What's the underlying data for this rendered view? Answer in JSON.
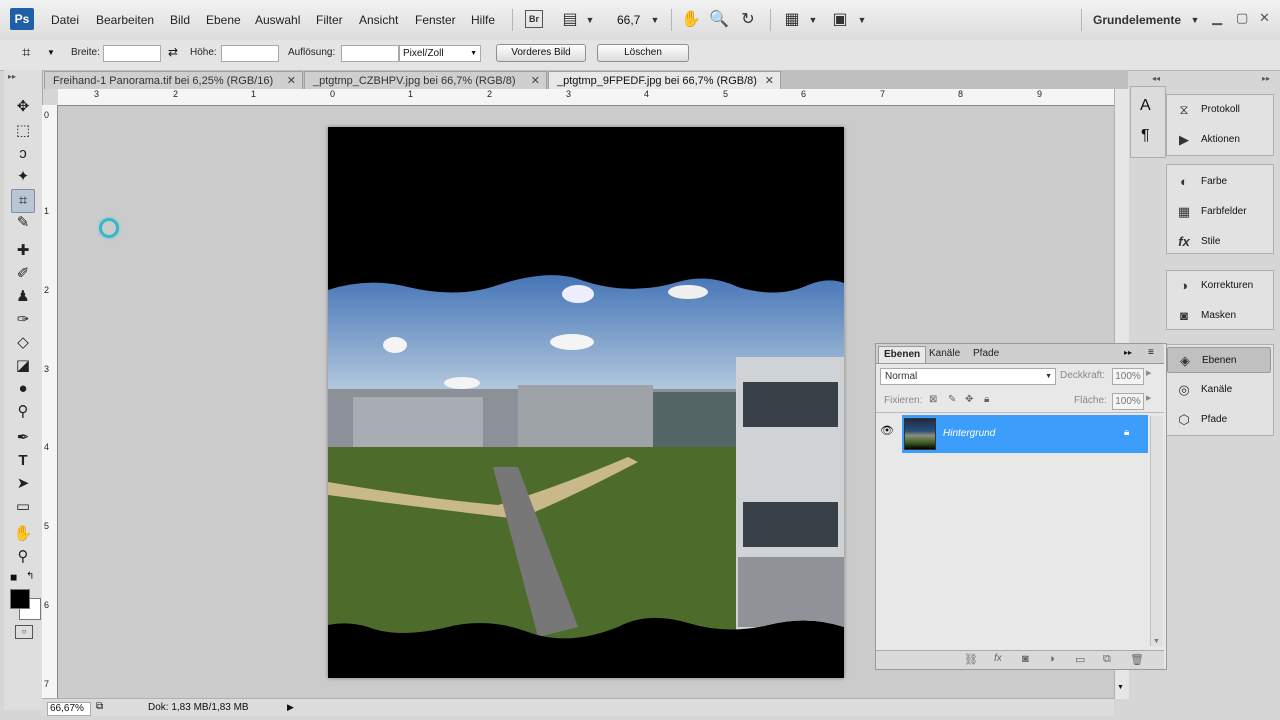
{
  "app": {
    "logo": "Ps",
    "workspace": "Grundelemente",
    "zoom_dropdown": "66,7"
  },
  "menu": [
    "Datei",
    "Bearbeiten",
    "Bild",
    "Ebene",
    "Auswahl",
    "Filter",
    "Ansicht",
    "Fenster",
    "Hilfe"
  ],
  "toolbar_icons": [
    "bridge-icon",
    "minibridge-icon",
    "hand-icon",
    "zoom-icon",
    "rotate-view-icon",
    "arrange-documents-icon",
    "screen-mode-icon"
  ],
  "options": {
    "width_label": "Breite:",
    "width_value": "",
    "height_label": "Höhe:",
    "height_value": "",
    "resolution_label": "Auflösung:",
    "resolution_value": "",
    "resolution_unit": "Pixel/Zoll",
    "front_image_button": "Vorderes Bild",
    "clear_button": "Löschen"
  },
  "tabs": [
    {
      "label": "Freihand-1 Panorama.tif bei 6,25% (RGB/16)",
      "active": false
    },
    {
      "label": "_ptgtmp_CZBHPV.jpg bei 66,7% (RGB/8)",
      "active": false
    },
    {
      "label": "_ptgtmp_9FPEDF.jpg bei 66,7% (RGB/8)",
      "active": true
    }
  ],
  "ruler": {
    "top": [
      "3",
      "2",
      "1",
      "0",
      "1",
      "2",
      "3",
      "4",
      "5",
      "6",
      "7",
      "8",
      "9"
    ],
    "left": [
      "0",
      "1",
      "2",
      "3",
      "4",
      "5",
      "6",
      "7"
    ]
  },
  "status": {
    "zoom": "66,67%",
    "doc": "Dok: 1,83 MB/1,83 MB"
  },
  "tools": [
    "move-icon",
    "marquee-icon",
    "lasso-icon",
    "magic-wand-icon",
    "crop-icon",
    "eyedropper-icon",
    "healing-brush-icon",
    "brush-icon",
    "clone-stamp-icon",
    "history-brush-icon",
    "eraser-icon",
    "paint-bucket-icon",
    "blur-icon",
    "dodge-icon",
    "pen-icon",
    "type-icon",
    "path-selection-icon",
    "shape-icon",
    "hand-tool-icon",
    "zoom-tool-icon"
  ],
  "dock": {
    "group1": [
      {
        "label": "Protokoll",
        "icon": "history-panel-icon"
      },
      {
        "label": "Aktionen",
        "icon": "actions-panel-icon"
      }
    ],
    "group2": [
      {
        "label": "Farbe",
        "icon": "color-panel-icon"
      },
      {
        "label": "Farbfelder",
        "icon": "swatches-panel-icon"
      },
      {
        "label": "Stile",
        "icon": "styles-panel-icon"
      }
    ],
    "group3": [
      {
        "label": "Korrekturen",
        "icon": "adjustments-panel-icon"
      },
      {
        "label": "Masken",
        "icon": "masks-panel-icon"
      }
    ],
    "group4": [
      {
        "label": "Ebenen",
        "icon": "layers-panel-icon",
        "active": true
      },
      {
        "label": "Kanäle",
        "icon": "channels-panel-icon"
      },
      {
        "label": "Pfade",
        "icon": "paths-panel-icon"
      }
    ]
  },
  "layers_panel": {
    "tabs": [
      "Ebenen",
      "Kanäle",
      "Pfade"
    ],
    "blend_mode": "Normal",
    "opacity_label": "Deckkraft:",
    "opacity_value": "100%",
    "lock_label": "Fixieren:",
    "fill_label": "Fläche:",
    "fill_value": "100%",
    "layer_name": "Hintergrund"
  },
  "colors": {
    "accent": "#3d9dfa",
    "selection": "#3d9dfa"
  }
}
